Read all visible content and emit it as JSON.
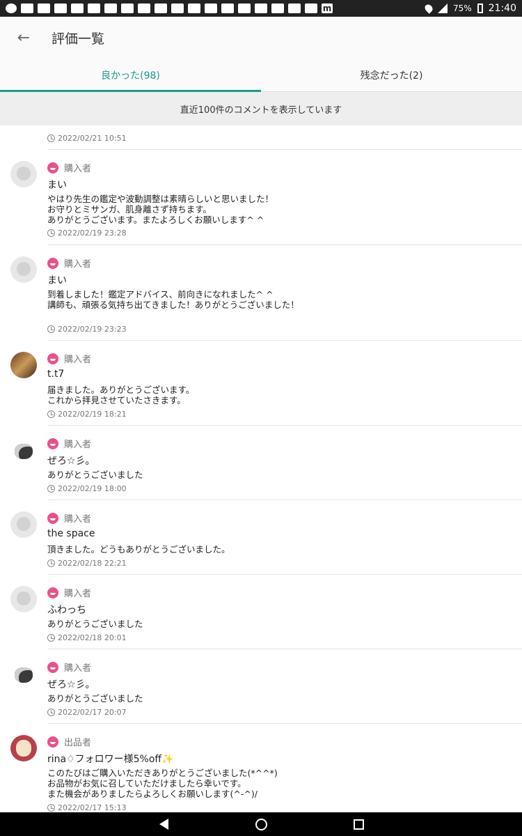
{
  "status_bar": {
    "battery": "75%",
    "time": "21:40"
  },
  "header": {
    "title": "評価一覧"
  },
  "tabs": [
    {
      "label": "良かった(98)",
      "active": true
    },
    {
      "label": "残念だった(2)",
      "active": false
    }
  ],
  "notice": "直近100件のコメントを表示しています",
  "reviews": [
    {
      "date": "2022/02/21 10:51"
    },
    {
      "role": "購入者",
      "name": "まい",
      "avatar": "default-avatar-icon",
      "comment": "やはり先生の鑑定や波動調整は素晴らしいと思いました！\nお守りとミサンガ、肌身離さず持ちます。\nありがとうございます。またよろしくお願いします^ ^",
      "date": "2022/02/19 23:28"
    },
    {
      "role": "購入者",
      "name": "まい",
      "avatar": "default-avatar-icon",
      "comment": "到着しました！鑑定アドバイス、前向きになれました^ ^\n講師も、頑張る気持ち出てきました！ありがとうございました！",
      "date": "2022/02/19 23:23"
    },
    {
      "role": "購入者",
      "name": "t.t7",
      "avatar": "photo-avatar",
      "comment": "届きました。ありがとうございます。\nこれから拝見させていたさきます。",
      "date": "2022/02/19 18:21"
    },
    {
      "role": "購入者",
      "name": "ぜろ☆彡｡",
      "avatar": "dog-avatar",
      "comment": "ありがとうございました",
      "date": "2022/02/19 18:00"
    },
    {
      "role": "購入者",
      "name": "the space",
      "avatar": "default-avatar-icon",
      "comment": "頂きました。どうもありがとうございました。",
      "date": "2022/02/18 22:21"
    },
    {
      "role": "購入者",
      "name": "ふわっち",
      "avatar": "default-avatar-icon",
      "comment": "ありがとうございました",
      "date": "2022/02/18 20:01"
    },
    {
      "role": "購入者",
      "name": "ぜろ☆彡｡",
      "avatar": "dog-avatar",
      "comment": "ありがとうございました",
      "date": "2022/02/17 20:07"
    },
    {
      "role": "出品者",
      "name": "rina♢フォロワー様5%off✨",
      "avatar": "seller-avatar",
      "comment": "このたびはご購入いただきありがとうございました(*^^*)\nお品物がお気に召していただけましたら幸いです。\nまた機会がありましたらよろしくお願いします(^-^)/",
      "date": "2022/02/17 15:13"
    }
  ]
}
